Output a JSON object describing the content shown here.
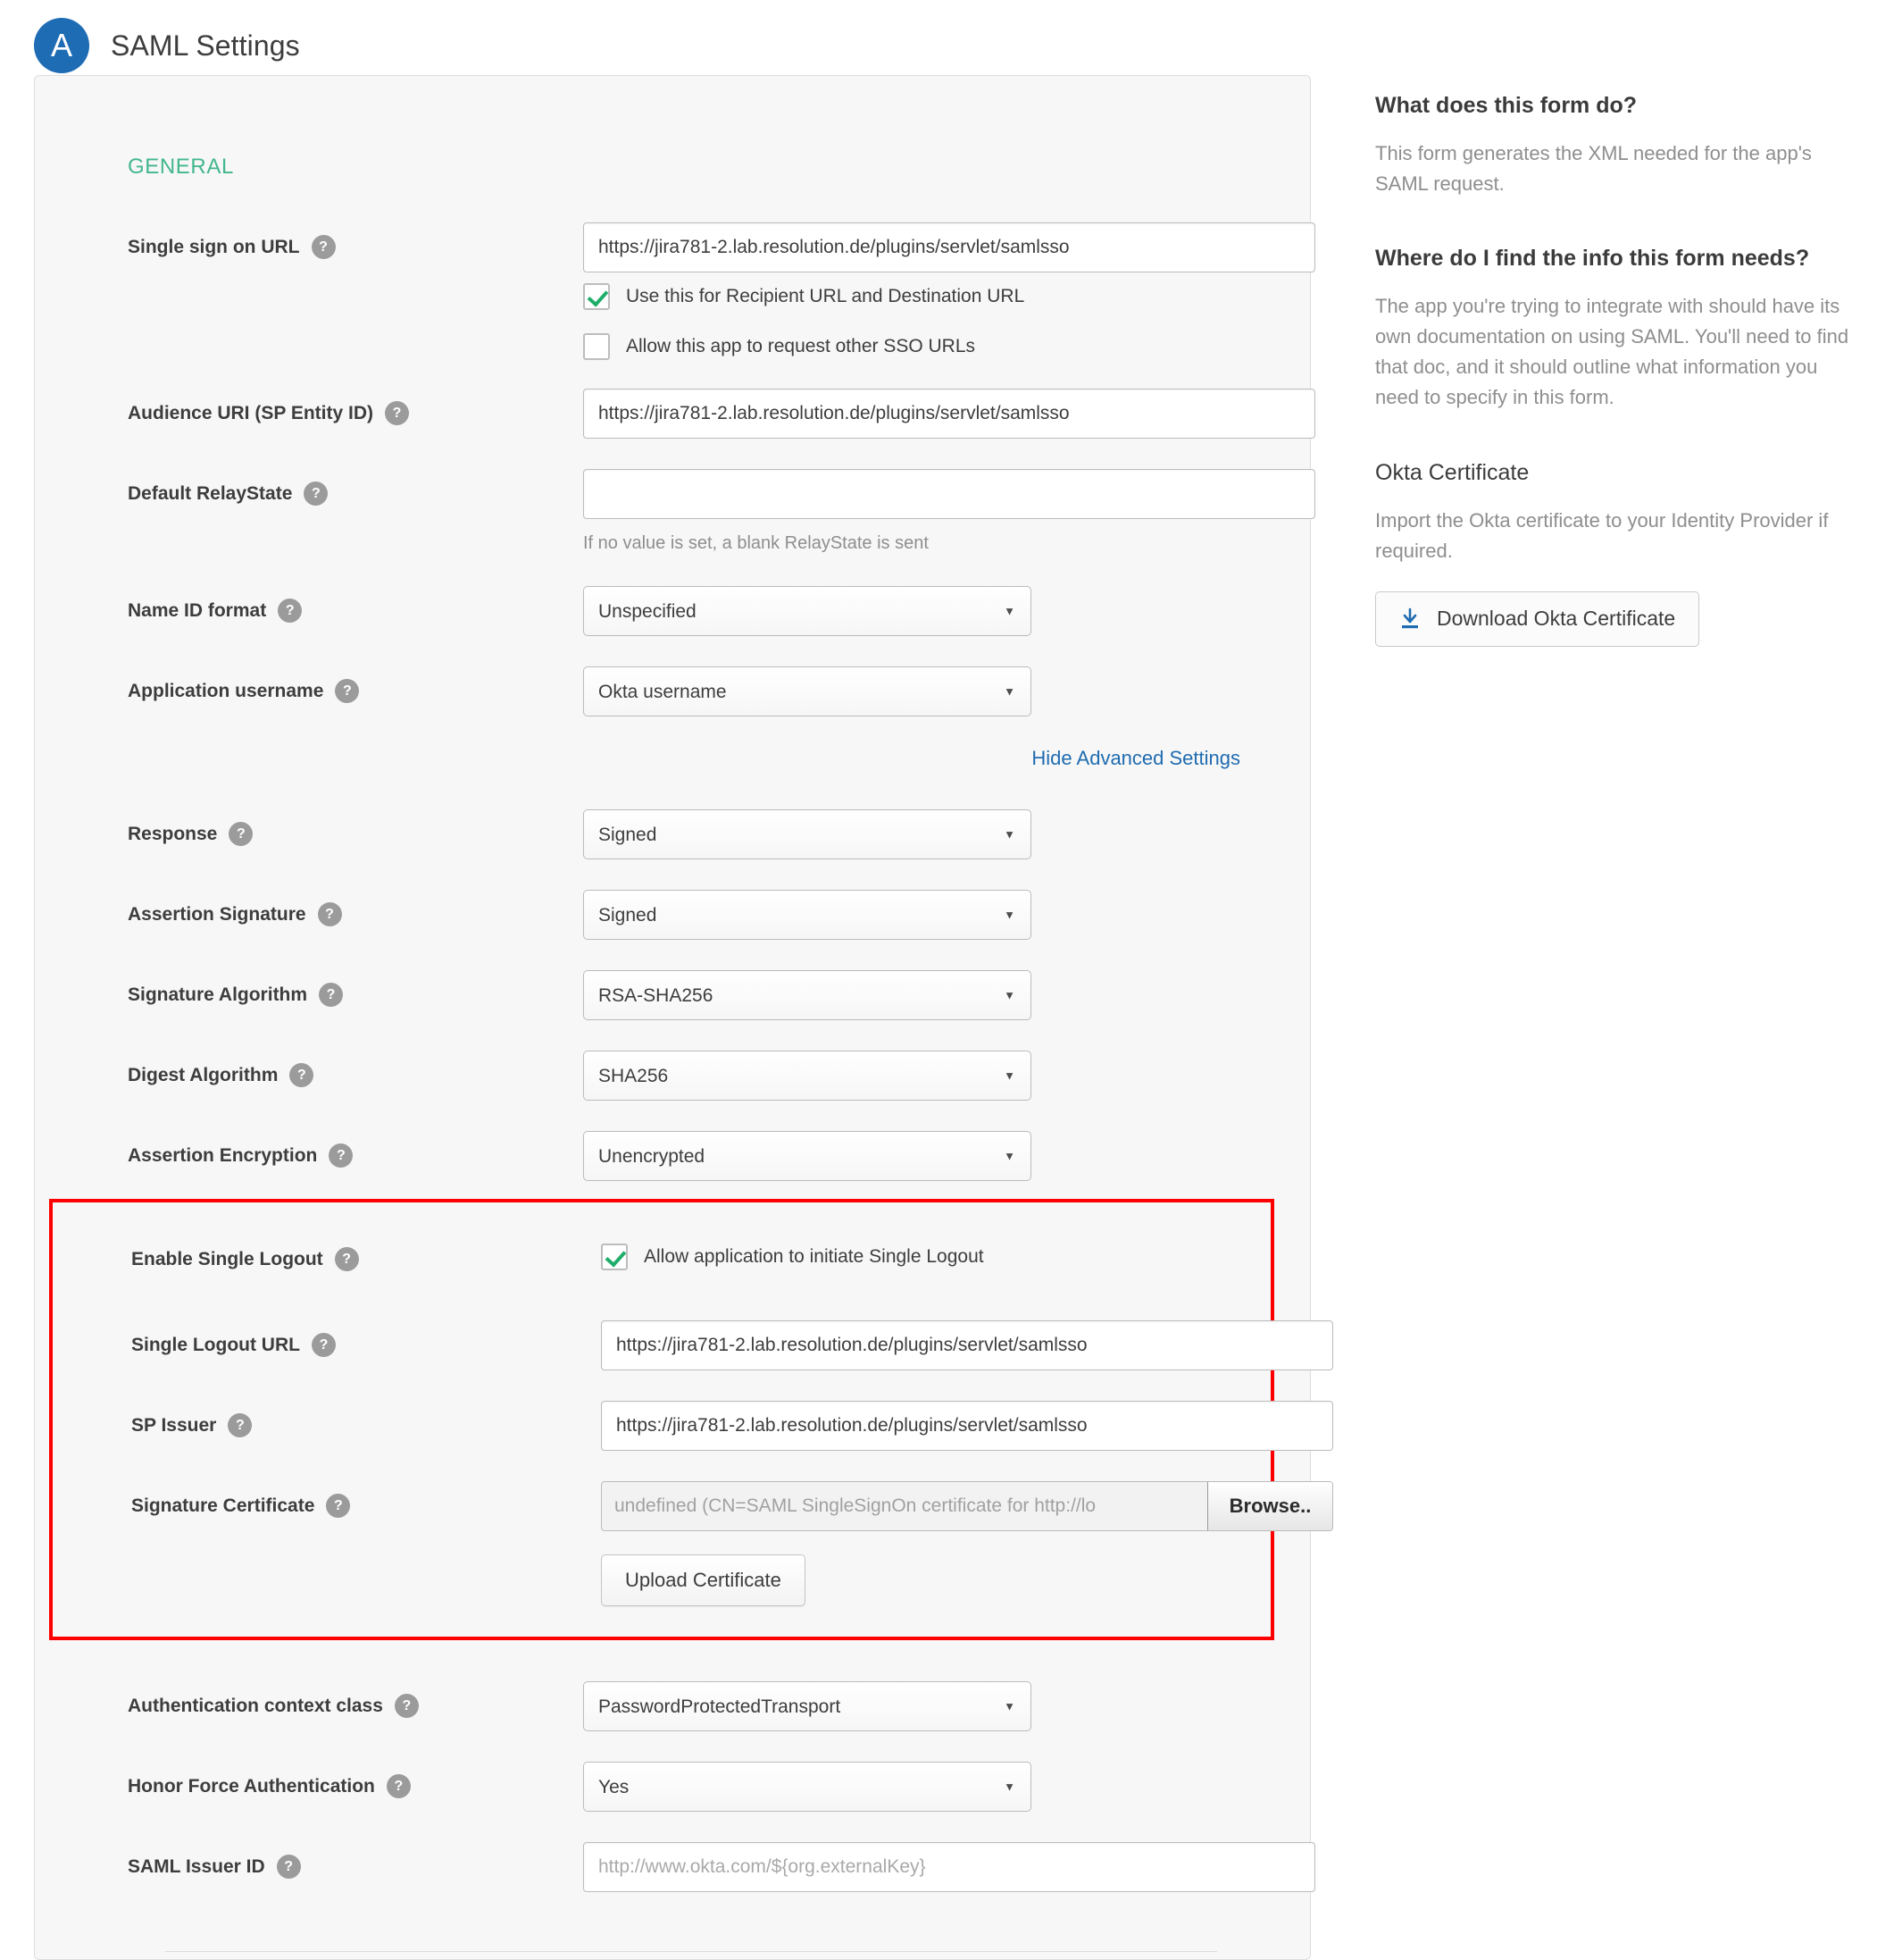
{
  "header": {
    "avatar_letter": "A",
    "title": "SAML Settings"
  },
  "form": {
    "section_title": "GENERAL",
    "fields": {
      "single_sign_on_url": {
        "label": "Single sign on URL",
        "value": "https://jira781-2.lab.resolution.de/plugins/servlet/samlsso",
        "help": "?"
      },
      "use_recipient": {
        "label": "Use this for Recipient URL and Destination URL",
        "checked": true
      },
      "allow_other_sso": {
        "label": "Allow this app to request other SSO URLs",
        "checked": false
      },
      "audience_uri": {
        "label": "Audience URI (SP Entity ID)",
        "value": "https://jira781-2.lab.resolution.de/plugins/servlet/samlsso"
      },
      "default_relaystate": {
        "label": "Default RelayState",
        "value": "",
        "hint": "If no value is set, a blank RelayState is sent"
      },
      "name_id_format": {
        "label": "Name ID format",
        "value": "Unspecified",
        "options": [
          "Unspecified"
        ]
      },
      "application_username": {
        "label": "Application username",
        "value": "Okta username",
        "options": [
          "Okta username"
        ]
      },
      "response": {
        "label": "Response",
        "value": "Signed",
        "options": [
          "Signed"
        ]
      },
      "assertion_signature": {
        "label": "Assertion Signature",
        "value": "Signed",
        "options": [
          "Signed"
        ]
      },
      "signature_algorithm": {
        "label": "Signature Algorithm",
        "value": "RSA-SHA256",
        "options": [
          "RSA-SHA256"
        ]
      },
      "digest_algorithm": {
        "label": "Digest Algorithm",
        "value": "SHA256",
        "options": [
          "SHA256"
        ]
      },
      "assertion_encryption": {
        "label": "Assertion Encryption",
        "value": "Unencrypted",
        "options": [
          "Unencrypted"
        ]
      },
      "enable_single_logout": {
        "label": "Enable Single Logout",
        "checkbox_label": "Allow application to initiate Single Logout",
        "checked": true
      },
      "single_logout_url": {
        "label": "Single Logout URL",
        "value": "https://jira781-2.lab.resolution.de/plugins/servlet/samlsso"
      },
      "sp_issuer": {
        "label": "SP Issuer",
        "value": "https://jira781-2.lab.resolution.de/plugins/servlet/samlsso"
      },
      "signature_certificate": {
        "label": "Signature Certificate",
        "file_name": "undefined (CN=SAML SingleSignOn certificate for http://lo",
        "browse_label": "Browse..",
        "upload_label": "Upload Certificate"
      },
      "authentication_context_class": {
        "label": "Authentication context class",
        "value": "PasswordProtectedTransport",
        "options": [
          "PasswordProtectedTransport"
        ]
      },
      "honor_force_authentication": {
        "label": "Honor Force Authentication",
        "value": "Yes",
        "options": [
          "Yes"
        ]
      },
      "saml_issuer_id": {
        "label": "SAML Issuer ID",
        "value": "",
        "placeholder": "http://www.okta.com/${org.externalKey}"
      }
    },
    "advanced_link": "Hide Advanced Settings"
  },
  "aside": {
    "what_heading": "What does this form do?",
    "what_body": "This form generates the XML needed for the app's SAML request.",
    "where_heading": "Where do I find the info this form needs?",
    "where_body": "The app you're trying to integrate with should have its own documentation on using SAML. You'll need to find that doc, and it should outline what information you need to specify in this form.",
    "cert_heading": "Okta Certificate",
    "cert_body": "Import the Okta certificate to your Identity Provider if required.",
    "download_label": "Download Okta Certificate"
  },
  "colors": {
    "accent_green": "#43b78d",
    "link_blue": "#1f6cb0",
    "avatar_blue": "#1e6cb4",
    "highlight_red": "#ff0000",
    "checkmark_green": "#1fae6a"
  }
}
